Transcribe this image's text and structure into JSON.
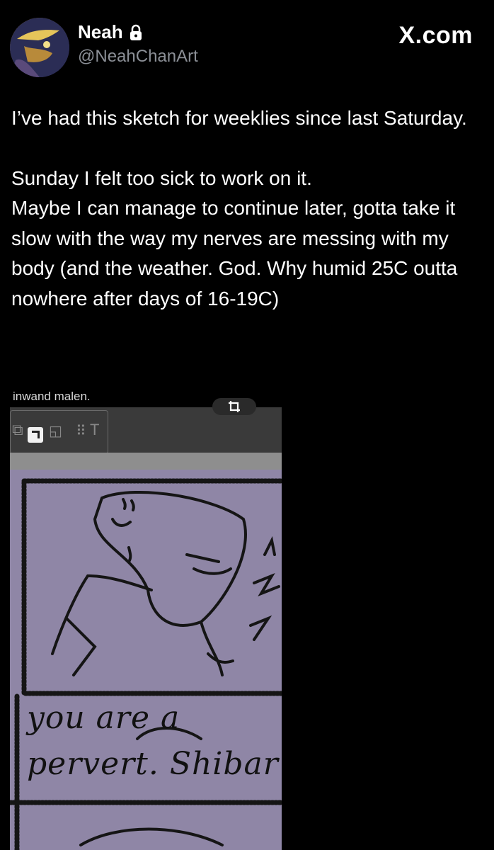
{
  "header": {
    "display_name": "Neah",
    "handle": "@NeahChanArt",
    "brand": "X.com",
    "icons": {
      "lock": "lock-icon",
      "crop": "crop-icon"
    }
  },
  "tweet": {
    "paragraphs": [
      "I’ve had this sketch for weeklies since last Saturday.",
      "Sunday I felt too sick to work on it.",
      "Maybe I can manage to continue later, gotta take it slow with the way my nerves are messing with my body (and the weather. God. Why humid 25C outta nowhere after days of 16-19C)"
    ]
  },
  "media": {
    "caption": "inwand malen.",
    "panel_text_line1": "you are a",
    "panel_text_line2": "pervert. Shibar"
  },
  "colors": {
    "background": "#000000",
    "handle": "#8b8f96",
    "canvas": "#8f86a6"
  }
}
